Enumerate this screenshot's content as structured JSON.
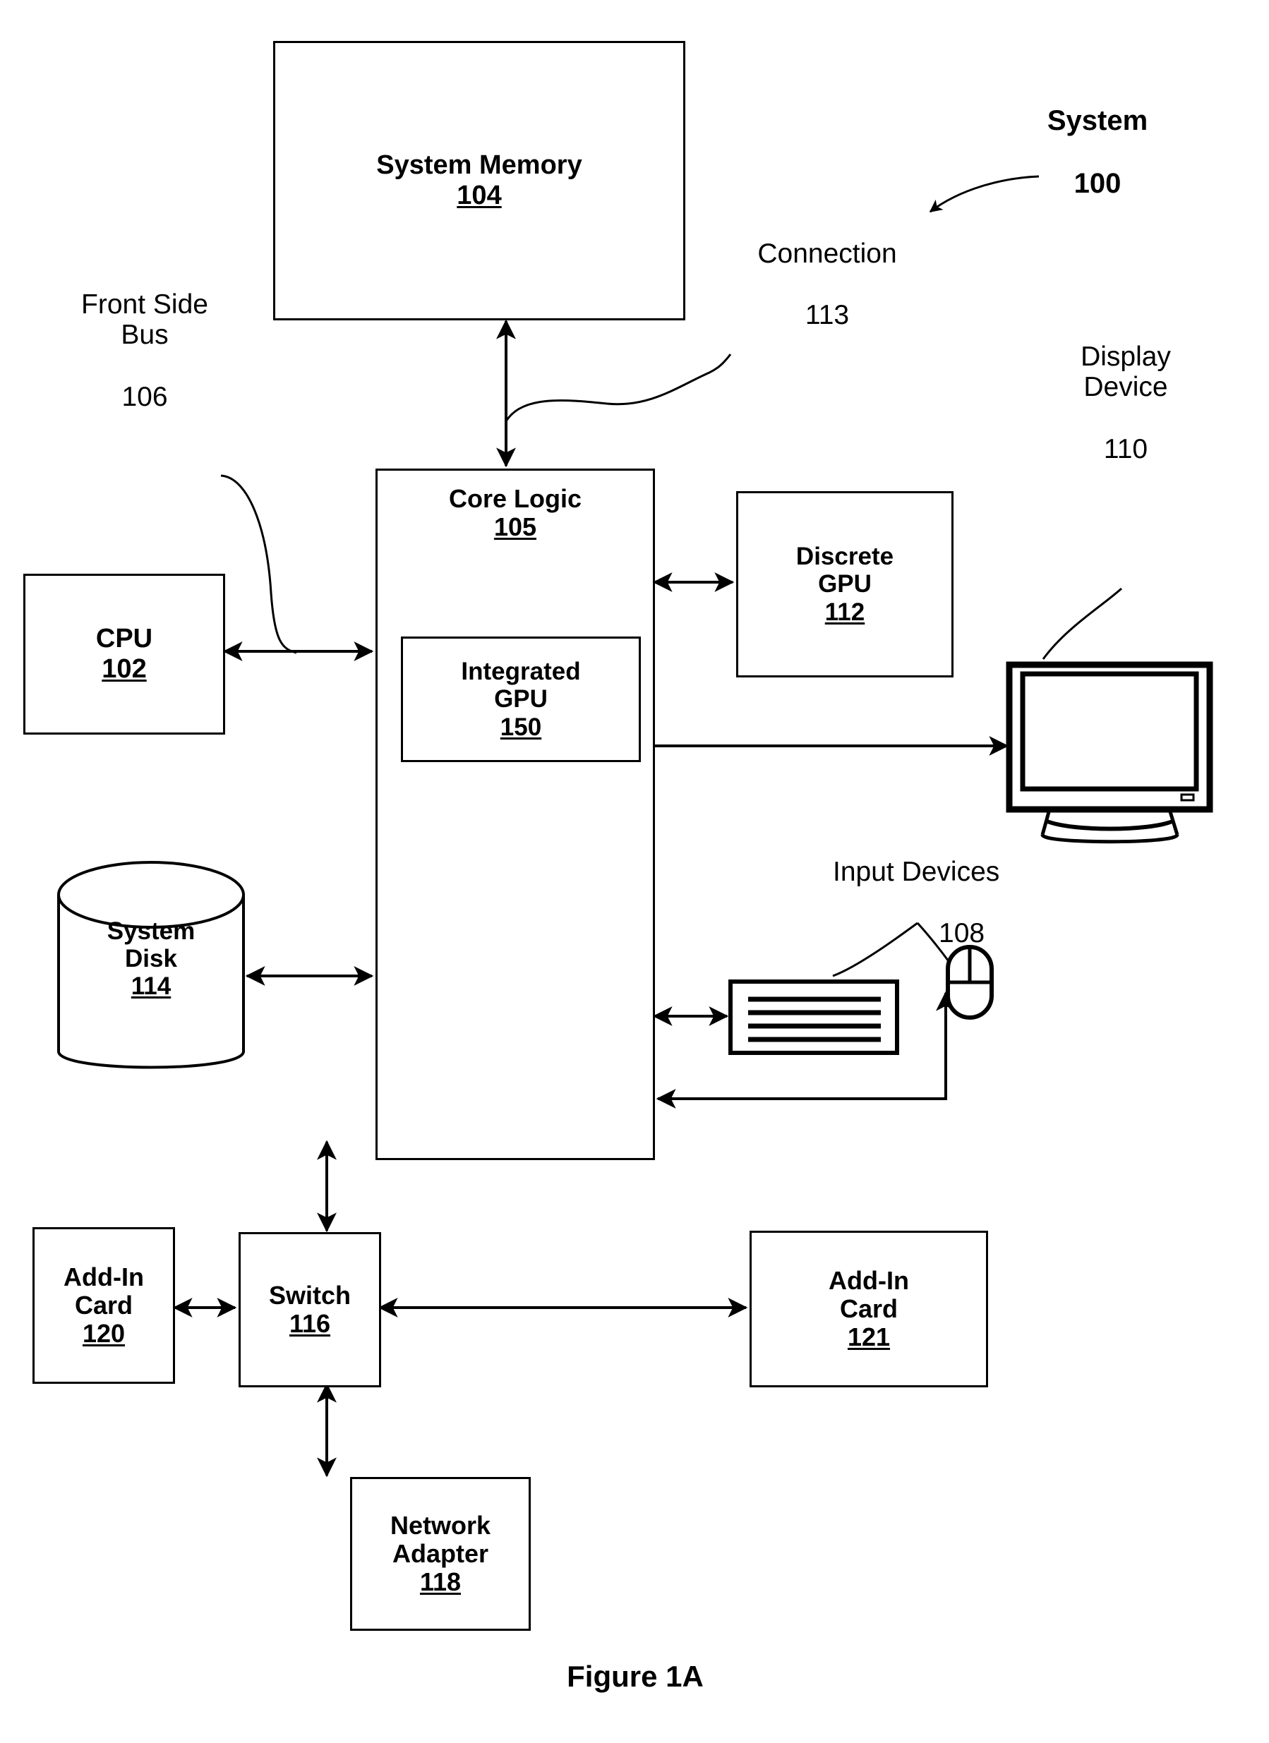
{
  "figure": {
    "caption": "Figure 1A",
    "system_label": "System",
    "system_number": "100"
  },
  "blocks": [
    {
      "id": "system-memory",
      "title": "System Memory",
      "number": "104"
    },
    {
      "id": "core-logic",
      "title": "Core Logic",
      "number": "105"
    },
    {
      "id": "integrated-gpu",
      "title": "Integrated\nGPU",
      "number": "150"
    },
    {
      "id": "discrete-gpu",
      "title": "Discrete\nGPU",
      "number": "112"
    },
    {
      "id": "cpu",
      "title": "CPU",
      "number": "102"
    },
    {
      "id": "system-disk",
      "title": "System\nDisk",
      "number": "114"
    },
    {
      "id": "switch",
      "title": "Switch",
      "number": "116"
    },
    {
      "id": "add-in-card-120",
      "title": "Add-In\nCard",
      "number": "120"
    },
    {
      "id": "add-in-card-121",
      "title": "Add-In\nCard",
      "number": "121"
    },
    {
      "id": "network-adapter",
      "title": "Network\nAdapter",
      "number": "118"
    }
  ],
  "callouts": [
    {
      "id": "connection",
      "text": "Connection",
      "number": "113"
    },
    {
      "id": "front-side-bus",
      "text": "Front Side\nBus",
      "number": "106"
    },
    {
      "id": "display-device",
      "text": "Display\nDevice",
      "number": "110"
    },
    {
      "id": "input-devices",
      "text": "Input Devices",
      "number": "108"
    }
  ],
  "icons": {
    "display": "monitor-icon",
    "keyboard": "keyboard-icon",
    "mouse": "mouse-icon",
    "disk": "cylinder-disk-icon"
  },
  "colors": {
    "stroke": "#000000",
    "background": "#ffffff"
  }
}
